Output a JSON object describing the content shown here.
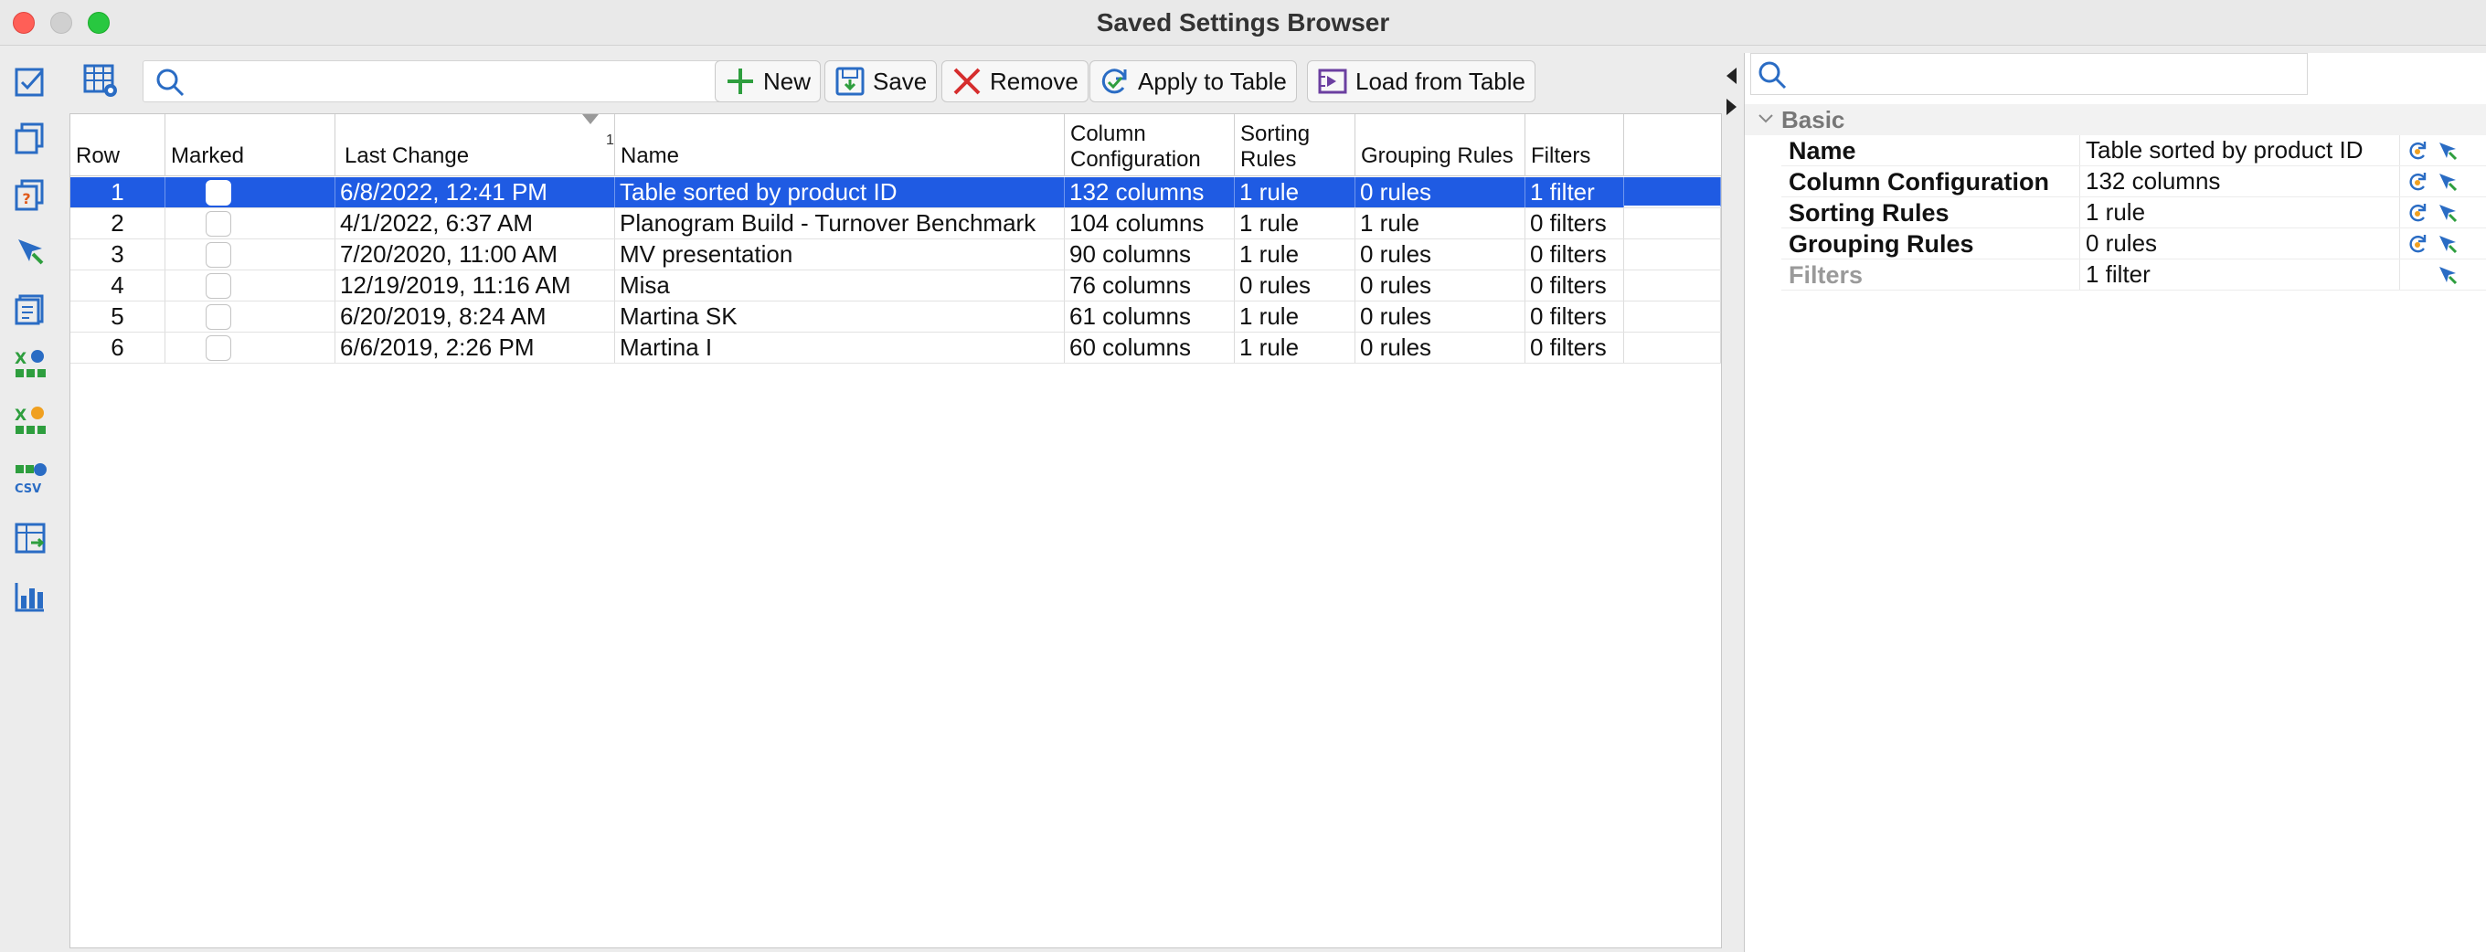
{
  "window": {
    "title": "Saved Settings Browser"
  },
  "toolbar": {
    "search_placeholder": "",
    "new_label": "New",
    "save_label": "Save",
    "remove_label": "Remove",
    "apply_label": "Apply to Table",
    "load_label": "Load from Table"
  },
  "table": {
    "headers": {
      "row": "Row",
      "marked": "Marked",
      "last_change": "Last Change",
      "sort_index": "1",
      "name": "Name",
      "column_configuration_1": "Column",
      "column_configuration_2": "Configuration",
      "sorting_rules_1": "Sorting",
      "sorting_rules_2": "Rules",
      "grouping_rules": "Grouping Rules",
      "filters": "Filters"
    },
    "rows": [
      {
        "row": "1",
        "last_change": "6/8/2022, 12:41 PM",
        "name": "Table sorted by product ID",
        "columns": "132 columns",
        "sorting": "1 rule",
        "grouping": "0 rules",
        "filters": "1 filter"
      },
      {
        "row": "2",
        "last_change": "4/1/2022, 6:37 AM",
        "name": "Planogram Build - Turnover Benchmark",
        "columns": "104 columns",
        "sorting": "1 rule",
        "grouping": "1 rule",
        "filters": "0 filters"
      },
      {
        "row": "3",
        "last_change": "7/20/2020, 11:00 AM",
        "name": "MV presentation",
        "columns": "90 columns",
        "sorting": "1 rule",
        "grouping": "0 rules",
        "filters": "0 filters"
      },
      {
        "row": "4",
        "last_change": "12/19/2019, 11:16 AM",
        "name": "Misa",
        "columns": "76 columns",
        "sorting": "0 rules",
        "grouping": "0 rules",
        "filters": "0 filters"
      },
      {
        "row": "5",
        "last_change": "6/20/2019, 8:24 AM",
        "name": "Martina SK",
        "columns": "61 columns",
        "sorting": "1 rule",
        "grouping": "0 rules",
        "filters": "0 filters"
      },
      {
        "row": "6",
        "last_change": "6/6/2019, 2:26 PM",
        "name": "Martina I",
        "columns": "60 columns",
        "sorting": "1 rule",
        "grouping": "0 rules",
        "filters": "0 filters"
      }
    ]
  },
  "properties": {
    "search_placeholder": "",
    "group": "Basic",
    "items": [
      {
        "name": "Name",
        "value": "Table sorted by product ID"
      },
      {
        "name": "Column Configuration",
        "value": "132 columns"
      },
      {
        "name": "Sorting Rules",
        "value": "1 rule"
      },
      {
        "name": "Grouping Rules",
        "value": "0 rules"
      },
      {
        "name": "Filters",
        "value": "1 filter"
      }
    ]
  },
  "colors": {
    "selection": "#1f5be3",
    "accent_green": "#2e9e3e",
    "remove_red": "#d62d2d",
    "icon_blue": "#2a6cc4"
  }
}
